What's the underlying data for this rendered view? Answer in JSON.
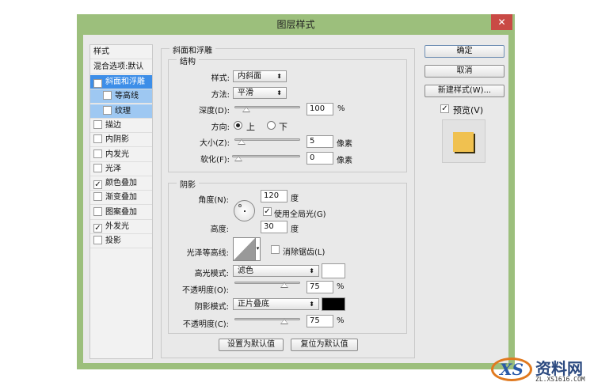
{
  "window": {
    "title": "图层样式",
    "close_icon": "close-icon"
  },
  "sidebar": {
    "header": "样式",
    "blend_options": "混合选项:默认",
    "items": [
      {
        "label": "斜面和浮雕",
        "checked": true,
        "selected": true
      },
      {
        "label": "等高线",
        "checked": false,
        "sub": true
      },
      {
        "label": "纹理",
        "checked": false,
        "sub": true
      },
      {
        "label": "描边",
        "checked": false
      },
      {
        "label": "内阴影",
        "checked": false
      },
      {
        "label": "内发光",
        "checked": false
      },
      {
        "label": "光泽",
        "checked": false
      },
      {
        "label": "颜色叠加",
        "checked": true
      },
      {
        "label": "渐变叠加",
        "checked": false
      },
      {
        "label": "图案叠加",
        "checked": false
      },
      {
        "label": "外发光",
        "checked": true
      },
      {
        "label": "投影",
        "checked": false
      }
    ]
  },
  "bevel": {
    "title": "斜面和浮雕",
    "structure": {
      "title": "结构",
      "style_label": "样式:",
      "style_value": "内斜面",
      "technique_label": "方法:",
      "technique_value": "平滑",
      "depth_label": "深度(D):",
      "depth_value": "100",
      "depth_unit": "%",
      "depth_max": 1000,
      "direction_label": "方向:",
      "direction_up": "上",
      "direction_down": "下",
      "direction_selected": "上",
      "size_label": "大小(Z):",
      "size_value": "5",
      "size_unit": "像素",
      "size_max": 250,
      "soften_label": "软化(F):",
      "soften_value": "0",
      "soften_unit": "像素",
      "soften_max": 16
    },
    "shading": {
      "title": "阴影",
      "angle_label": "角度(N):",
      "angle_value": "120",
      "angle_unit": "度",
      "global_light_label": "使用全局光(G)",
      "global_light_checked": true,
      "altitude_label": "高度:",
      "altitude_value": "30",
      "altitude_unit": "度",
      "gloss_contour_label": "光泽等高线:",
      "anti_alias_label": "消除锯齿(L)",
      "anti_alias_checked": false,
      "highlight_mode_label": "高光模式:",
      "highlight_mode_value": "滤色",
      "highlight_color": "#ffffff",
      "highlight_opacity_label": "不透明度(O):",
      "highlight_opacity_value": "75",
      "highlight_opacity_unit": "%",
      "shadow_mode_label": "阴影模式:",
      "shadow_mode_value": "正片叠底",
      "shadow_color": "#000000",
      "shadow_opacity_label": "不透明度(C):",
      "shadow_opacity_value": "75",
      "shadow_opacity_unit": "%"
    },
    "make_default": "设置为默认值",
    "reset_default": "复位为默认值"
  },
  "right": {
    "ok": "确定",
    "cancel": "取消",
    "new_style": "新建样式(W)...",
    "preview_label": "预览(V)",
    "preview_checked": true,
    "preview_color": "#f0c150"
  },
  "watermark": {
    "text": "资料网",
    "url_text": "ZL.XS1616.COM",
    "logo_text": "XS"
  }
}
